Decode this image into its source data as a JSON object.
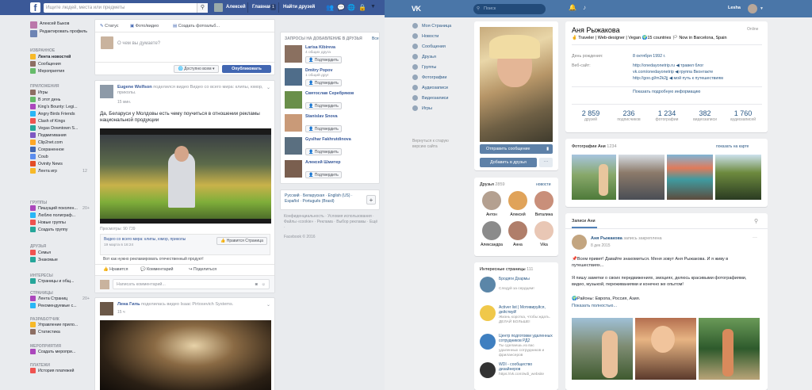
{
  "fb": {
    "search_placeholder": "Ищите людей, места или предметы",
    "user_name": "Алексей",
    "home": "Главная",
    "home_count": "1",
    "find_friends": "Найти друзей",
    "sidebar": {
      "profile_name": "Алексей Быков",
      "edit_profile": "Редактировать профиль",
      "favorites_title": "ИЗБРАННОЕ",
      "favorites": [
        "Лента новостей",
        "Сообщения",
        "Мероприятия"
      ],
      "apps_title": "ПРИЛОЖЕНИЯ",
      "apps": [
        "Игры",
        "В этот день",
        "King's Bounty: Legi...",
        "Angry Birds Friends",
        "Clash of Kings",
        "Vegas Downtown S...",
        "Подмигивания",
        "Clip2net.com",
        "Сохраненное",
        "Coub",
        "Ovinity News",
        "Лента игр"
      ],
      "apps_counts": [
        "",
        "",
        "",
        "",
        "",
        "",
        "",
        "",
        "",
        "",
        "",
        "12"
      ],
      "groups_title": "ГРУППЫ",
      "groups": [
        "Пишущий поколен...",
        "Люблю полиграф...",
        "Новые группы",
        "Создать группу"
      ],
      "groups_counts": [
        "20+",
        "",
        "",
        ""
      ],
      "friends_title": "ДРУЗЬЯ",
      "friends": [
        "Семья",
        "Знакомые"
      ],
      "interests_title": "ИНТЕРЕСЫ",
      "interests": [
        "Страницы и общ..."
      ],
      "pages_title": "СТРАНИЦЫ",
      "pages": [
        "Лента Страниц",
        "Рекомендуемые с..."
      ],
      "pages_counts": [
        "20+",
        ""
      ],
      "dev_title": "РАЗРАБОТЧИК",
      "dev": [
        "Управление прило...",
        "Статистика"
      ],
      "events_title": "МЕРОПРИЯТИЯ",
      "events": [
        "Создать меропри..."
      ],
      "payments_title": "ПЛАТЕЖИ",
      "payments": [
        "История платежей"
      ]
    },
    "composer": {
      "status": "Статус",
      "photo_video": "Фото/видео",
      "album": "Создать фотоальб...",
      "placeholder": "О чем вы думаете?",
      "audience": "Доступно всем",
      "publish": "Опубликовать"
    },
    "post1": {
      "author": "Eugene Wolfson",
      "action": "поделился видео Видео со всего мира: клипы, юмор, приколы.",
      "time": "15 мин.",
      "text": "Да, Беларуси у Молдовы есть чему поучиться в отношении рекламы национальной продукции",
      "views": "Просмотры: 90 739",
      "source_title": "Видео со всего мира: клипы, юмор, приколы",
      "source_date": "19 марта в 16:24",
      "like_page": "Нравится Страница",
      "caption": "Вот как нужно рекламировать отечественный продукт!",
      "like": "Нравится",
      "comment": "Комментарий",
      "share": "Поделиться",
      "write_comment": "Написать комментарий..."
    },
    "post2": {
      "author": "Лена Гиль",
      "action": "поделилась видео Isaac Pirtosevich Systems.",
      "time": "15 ч"
    },
    "requests": {
      "title": "ЗАПРОСЫ НА ДОБАВЛЕНИЕ В ДРУЗЬЯ",
      "all": "Все",
      "confirm": "Подтвердить",
      "people": [
        {
          "name": "Larisa Kibireva",
          "mutual": "4 общих друга"
        },
        {
          "name": "Dmitry Popov",
          "mutual": "1 общий друг"
        },
        {
          "name": "Святослав Серебряков",
          "mutual": ""
        },
        {
          "name": "Stanislav Snova",
          "mutual": ""
        },
        {
          "name": "Gyslhar Fakhrutdinova",
          "mutual": ""
        },
        {
          "name": "Алексей Шмитер",
          "mutual": ""
        }
      ]
    },
    "languages": "Русский · Беларуская · English (US) · Español · Português (Brasil)",
    "footer": "Конфиденциальность · Условия использования · Файлы «cookie» · Реклама · Выбор рекламы · Ещё ·",
    "copyright": "Facebook © 2016"
  },
  "vk": {
    "logo": "VK",
    "search": "Поиск",
    "user": "Lesha",
    "nav": [
      "Моя Страница",
      "Новости",
      "Сообщения",
      "Друзья",
      "Группы",
      "Фотографии",
      "Аудиозаписи",
      "Видеозаписи",
      "Игры"
    ],
    "old_version": "Вернуться к старую версию сайта",
    "send_message": "Отправить сообщение",
    "add_friend": "Добавить в друзья",
    "profile": {
      "name": "Аня Рыжакова",
      "status": "Online",
      "bio": "✌ Traveler | Web-designer | Vegan 🌍15 countries 🏳 Now in Barcelona, Spain",
      "birthday_label": "День рождения:",
      "birthday": "8 октября 1992 г.",
      "website_label": "Веб-сайт:",
      "websites": [
        "http://onedayonetrip.ru ◀ травел блог",
        "vk.com/onedayonetrip ◀ группа Вконтакте",
        "http://goo.gl/m2k2jj ◀ мой путь к путешествиям"
      ],
      "more": "Показать подробную информацию",
      "stats": [
        {
          "num": "2 859",
          "label": "друзей"
        },
        {
          "num": "236",
          "label": "подписчиков"
        },
        {
          "num": "1 234",
          "label": "фотографии"
        },
        {
          "num": "382",
          "label": "видеозаписи"
        },
        {
          "num": "1 760",
          "label": "аудиозаписей"
        }
      ]
    },
    "photos_title": "Фотографии Ани",
    "photos_count": "1234",
    "show_on_map": "показать на карте",
    "friends_title": "Друзья",
    "friends_count": "2859",
    "friends_updates": "новости",
    "friends": [
      "Антон",
      "Алексей",
      "Виталина",
      "Александра",
      "Анна",
      "Vika"
    ],
    "interesting_title": "Интересные страницы",
    "interesting_count": "111",
    "pages": [
      {
        "name": "Бродяги Дхармы",
        "desc": "Следуй за сердцем!"
      },
      {
        "name": "Activer list | Мотивируйся, действуй!",
        "desc": "Жизнь коротка, чтобы ждать. ДЕЛАЙ БОЛЬШЕ!"
      },
      {
        "name": "Центр подготовки удаленных сотрудников РД2",
        "desc": "Ты сделаешь из вас удаленных сотрудников и фрилансеров"
      },
      {
        "name": "WDI - сообщество дизайнеров",
        "desc": "https://vk.com/wdi_website"
      }
    ],
    "wall_title": "Записи Ани",
    "post": {
      "author": "Аня Рыжакова",
      "pinned": "запись закреплена",
      "date": "8 дек 2015",
      "line1": "📌Всем привет! Давайте знакомиться. Меня зовут Аня Рыжакова. И я живу в путешествиях...",
      "line2": "Я пишу заметки о своих передвижениях, эмоциях, делюсь красивыми фотографиями, видео, музыкой, переживаниями и конечно же опытом!",
      "line3": "🌍Районы: Европа, Россия, Азия.",
      "more": "Показать полностью..."
    }
  },
  "colors": {
    "fb_blue": "#3b5998",
    "vk_blue": "#4a76a8",
    "fb_bg": "#e9ebee",
    "vk_bg": "#edeef0"
  }
}
